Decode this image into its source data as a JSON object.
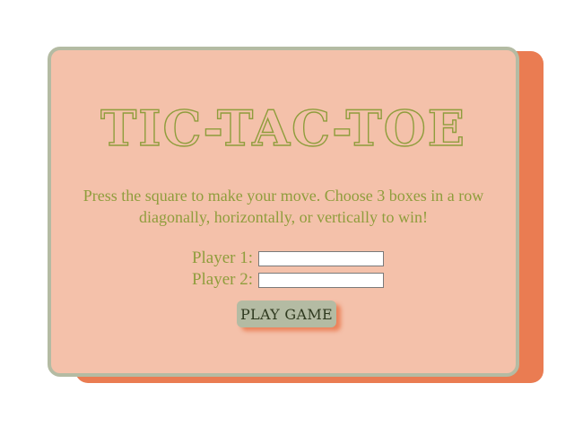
{
  "game": {
    "title": "TIC-TAC-TOE",
    "instructions": "Press the square to make your move. Choose 3 boxes in a row diagonally, horizontally, or vertically to win!",
    "player1_label": "Player 1:",
    "player2_label": "Player 2:",
    "player1_value": "",
    "player2_value": "",
    "play_button_label": "PLAY GAME"
  },
  "colors": {
    "card_background": "#f4c1aa",
    "card_border": "#b4bba3",
    "shadow_card": "#ea7c52",
    "text_accent": "#8f9d3c",
    "button_background": "#b4bba3"
  }
}
